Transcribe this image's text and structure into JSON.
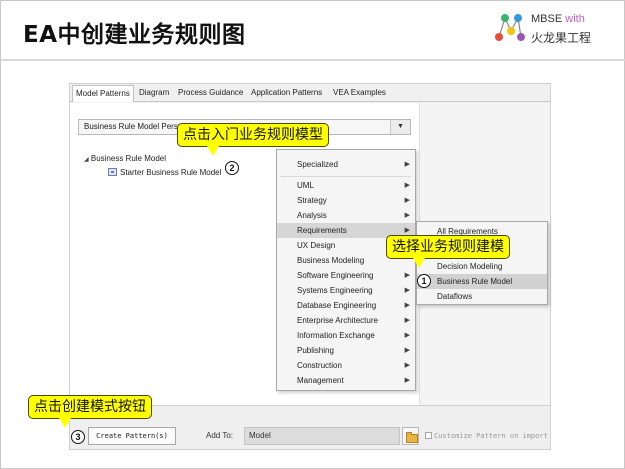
{
  "slide": {
    "title": "EA中创建业务规则图"
  },
  "logo": {
    "brand": "MBSE",
    "accent": "with",
    "subtitle": "火龙果工程",
    "accent_color": "#c060c0",
    "dot_colors": [
      "#e84c3d",
      "#3cb371",
      "#f1c40f",
      "#3498db",
      "#9b59b6"
    ]
  },
  "tabs": [
    {
      "label": "Model Patterns"
    },
    {
      "label": "Diagram"
    },
    {
      "label": "Process Guidance"
    },
    {
      "label": "Application Patterns"
    },
    {
      "label": "VEA Examples"
    }
  ],
  "perspective": {
    "value": "Business Rule Model Persp"
  },
  "tree": {
    "root": "Business Rule Model",
    "child": "Starter Business Rule Model"
  },
  "menu": {
    "items": [
      {
        "label": "Specialized",
        "has_submenu": true
      },
      {
        "label": "UML",
        "has_submenu": true
      },
      {
        "label": "Strategy",
        "has_submenu": true
      },
      {
        "label": "Analysis",
        "has_submenu": true
      },
      {
        "label": "Requirements",
        "has_submenu": true
      },
      {
        "label": "UX Design",
        "has_submenu": false
      },
      {
        "label": "Business Modeling",
        "has_submenu": false
      },
      {
        "label": "Software Engineering",
        "has_submenu": true
      },
      {
        "label": "Systems Engineering",
        "has_submenu": true
      },
      {
        "label": "Database Engineering",
        "has_submenu": true
      },
      {
        "label": "Enterprise Architecture",
        "has_submenu": true
      },
      {
        "label": "Information Exchange",
        "has_submenu": true
      },
      {
        "label": "Publishing",
        "has_submenu": true
      },
      {
        "label": "Construction",
        "has_submenu": true
      },
      {
        "label": "Management",
        "has_submenu": true
      }
    ],
    "arrow_glyph": "▶"
  },
  "submenu": {
    "items": [
      {
        "label": "All Requirements"
      },
      {
        "label": "Decision Modeling"
      },
      {
        "label": "Business Rule Model"
      },
      {
        "label": "Dataflows"
      }
    ]
  },
  "bottom": {
    "create_button": "Create Pattern(s)",
    "add_to_label": "Add To:",
    "add_to_value": "Model",
    "customize_label": "Customize Pattern on import"
  },
  "callouts": {
    "step1_text": "选择业务规则建模",
    "step1_num": "1",
    "step2_text": "点击入门业务规则模型",
    "step2_num": "2",
    "step3_text": "点击创建模式按钮",
    "step3_num": "3",
    "color": "#ffff00"
  }
}
